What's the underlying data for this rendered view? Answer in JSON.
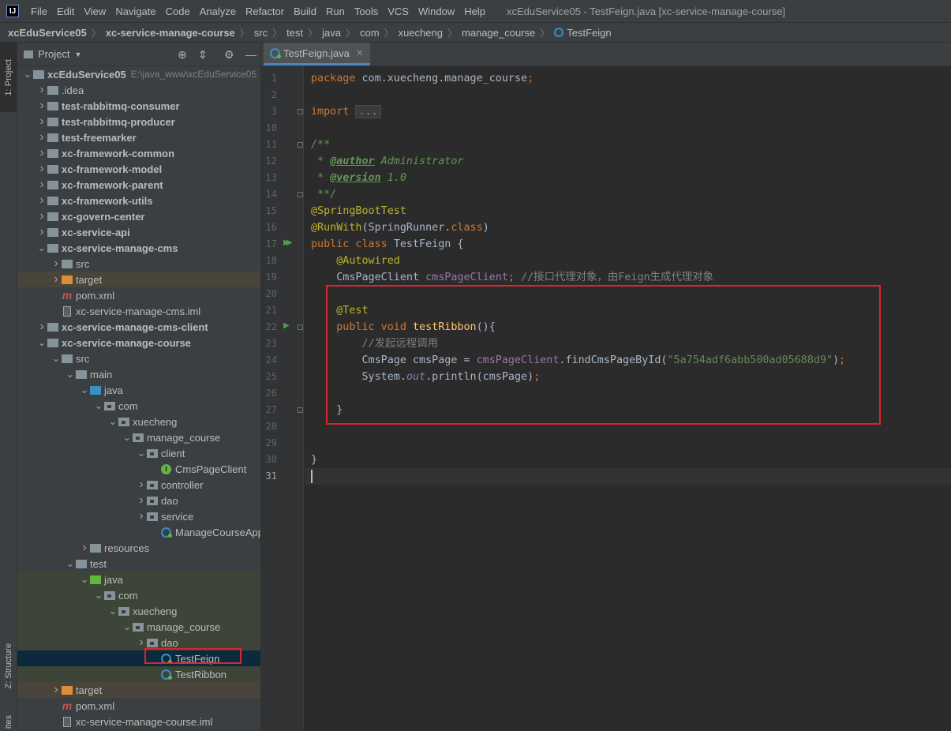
{
  "app": {
    "logo_text": "IJ",
    "window_title": "xcEduService05 - TestFeign.java [xc-service-manage-course]"
  },
  "menu": [
    "File",
    "Edit",
    "View",
    "Navigate",
    "Code",
    "Analyze",
    "Refactor",
    "Build",
    "Run",
    "Tools",
    "VCS",
    "Window",
    "Help"
  ],
  "breadcrumb": [
    "xcEduService05",
    "xc-service-manage-course",
    "src",
    "test",
    "java",
    "com",
    "xuecheng",
    "manage_course",
    "TestFeign"
  ],
  "toolwindows": {
    "project": "1: Project",
    "structure": "Z: Structure",
    "favorites": "ites"
  },
  "project_panel": {
    "title": "Project",
    "tree": [
      {
        "label": "xcEduService05",
        "path": "E:\\java_www\\xcEduService05",
        "depth": 0,
        "arrow": "down",
        "icon": "folder-grey",
        "bold": true
      },
      {
        "label": ".idea",
        "depth": 1,
        "arrow": "right",
        "icon": "folder-grey"
      },
      {
        "label": "test-rabbitmq-consumer",
        "depth": 1,
        "arrow": "right",
        "icon": "folder-grey",
        "bold": true
      },
      {
        "label": "test-rabbitmq-producer",
        "depth": 1,
        "arrow": "right",
        "icon": "folder-grey",
        "bold": true
      },
      {
        "label": "test-freemarker",
        "depth": 1,
        "arrow": "right",
        "icon": "folder-grey",
        "bold": true
      },
      {
        "label": "xc-framework-common",
        "depth": 1,
        "arrow": "right",
        "icon": "folder-grey",
        "bold": true
      },
      {
        "label": "xc-framework-model",
        "depth": 1,
        "arrow": "right",
        "icon": "folder-grey",
        "bold": true
      },
      {
        "label": "xc-framework-parent",
        "depth": 1,
        "arrow": "right",
        "icon": "folder-grey",
        "bold": true
      },
      {
        "label": "xc-framework-utils",
        "depth": 1,
        "arrow": "right",
        "icon": "folder-grey",
        "bold": true
      },
      {
        "label": "xc-govern-center",
        "depth": 1,
        "arrow": "right",
        "icon": "folder-grey",
        "bold": true
      },
      {
        "label": "xc-service-api",
        "depth": 1,
        "arrow": "right",
        "icon": "folder-grey",
        "bold": true
      },
      {
        "label": "xc-service-manage-cms",
        "depth": 1,
        "arrow": "down",
        "icon": "folder-grey",
        "bold": true
      },
      {
        "label": "src",
        "depth": 2,
        "arrow": "right",
        "icon": "folder-grey"
      },
      {
        "label": "target",
        "depth": 2,
        "arrow": "right",
        "icon": "folder-orange",
        "highlight": "orange"
      },
      {
        "label": "pom.xml",
        "depth": 2,
        "arrow": "",
        "icon": "maven"
      },
      {
        "label": "xc-service-manage-cms.iml",
        "depth": 2,
        "arrow": "",
        "icon": "iml"
      },
      {
        "label": "xc-service-manage-cms-client",
        "depth": 1,
        "arrow": "right",
        "icon": "folder-grey",
        "bold": true
      },
      {
        "label": "xc-service-manage-course",
        "depth": 1,
        "arrow": "down",
        "icon": "folder-grey",
        "bold": true
      },
      {
        "label": "src",
        "depth": 2,
        "arrow": "down",
        "icon": "folder-grey"
      },
      {
        "label": "main",
        "depth": 3,
        "arrow": "down",
        "icon": "folder-grey"
      },
      {
        "label": "java",
        "depth": 4,
        "arrow": "down",
        "icon": "folder-blue"
      },
      {
        "label": "com",
        "depth": 5,
        "arrow": "down",
        "icon": "package"
      },
      {
        "label": "xuecheng",
        "depth": 6,
        "arrow": "down",
        "icon": "package"
      },
      {
        "label": "manage_course",
        "depth": 7,
        "arrow": "down",
        "icon": "package"
      },
      {
        "label": "client",
        "depth": 8,
        "arrow": "down",
        "icon": "package"
      },
      {
        "label": "CmsPageClient",
        "depth": 9,
        "arrow": "",
        "icon": "interface"
      },
      {
        "label": "controller",
        "depth": 8,
        "arrow": "right",
        "icon": "package"
      },
      {
        "label": "dao",
        "depth": 8,
        "arrow": "right",
        "icon": "package"
      },
      {
        "label": "service",
        "depth": 8,
        "arrow": "right",
        "icon": "package"
      },
      {
        "label": "ManageCourseApplic",
        "depth": 9,
        "arrow": "",
        "icon": "class"
      },
      {
        "label": "resources",
        "depth": 4,
        "arrow": "right",
        "icon": "folder-grey"
      },
      {
        "label": "test",
        "depth": 3,
        "arrow": "down",
        "icon": "folder-grey"
      },
      {
        "label": "java",
        "depth": 4,
        "arrow": "down",
        "icon": "folder-green",
        "highlight": "green"
      },
      {
        "label": "com",
        "depth": 5,
        "arrow": "down",
        "icon": "package",
        "highlight": "green"
      },
      {
        "label": "xuecheng",
        "depth": 6,
        "arrow": "down",
        "icon": "package",
        "highlight": "green"
      },
      {
        "label": "manage_course",
        "depth": 7,
        "arrow": "down",
        "icon": "package",
        "highlight": "green"
      },
      {
        "label": "dao",
        "depth": 8,
        "arrow": "right",
        "icon": "package",
        "highlight": "green"
      },
      {
        "label": "TestFeign",
        "depth": 9,
        "arrow": "",
        "icon": "class",
        "highlight": "selected"
      },
      {
        "label": "TestRibbon",
        "depth": 9,
        "arrow": "",
        "icon": "class",
        "highlight": "green"
      },
      {
        "label": "target",
        "depth": 2,
        "arrow": "right",
        "icon": "folder-orange",
        "highlight": "orange"
      },
      {
        "label": "pom.xml",
        "depth": 2,
        "arrow": "",
        "icon": "maven"
      },
      {
        "label": "xc-service-manage-course.iml",
        "depth": 2,
        "arrow": "",
        "icon": "iml"
      }
    ]
  },
  "editor": {
    "tab_label": "TestFeign.java",
    "lines": [
      {
        "no": "1",
        "tokens": [
          [
            "kw",
            "package "
          ],
          [
            "",
            "com.xuecheng.manage_course"
          ],
          [
            "kw",
            ";"
          ]
        ]
      },
      {
        "no": "2",
        "tokens": []
      },
      {
        "no": "3",
        "tokens": [
          [
            "kw",
            "import "
          ],
          [
            "folded",
            "..."
          ]
        ],
        "fold": true
      },
      {
        "no": "10",
        "tokens": []
      },
      {
        "no": "11",
        "tokens": [
          [
            "doc",
            "/**"
          ]
        ],
        "fold": true
      },
      {
        "no": "12",
        "tokens": [
          [
            "doc",
            " * "
          ],
          [
            "doctag",
            "@author"
          ],
          [
            "doc",
            " Administrator"
          ]
        ]
      },
      {
        "no": "13",
        "tokens": [
          [
            "doc",
            " * "
          ],
          [
            "doctag",
            "@version"
          ],
          [
            "doc",
            " 1.0"
          ]
        ]
      },
      {
        "no": "14",
        "tokens": [
          [
            "doc",
            " **/"
          ]
        ],
        "fold": true
      },
      {
        "no": "15",
        "tokens": [
          [
            "ann",
            "@SpringBootTest"
          ]
        ]
      },
      {
        "no": "16",
        "tokens": [
          [
            "ann",
            "@RunWith"
          ],
          [
            "",
            "(SpringRunner."
          ],
          [
            "kw",
            "class"
          ],
          [
            "",
            ")"
          ]
        ]
      },
      {
        "no": "17",
        "tokens": [
          [
            "kw",
            "public class "
          ],
          [
            "",
            "TestFeign {"
          ]
        ],
        "run": "double"
      },
      {
        "no": "18",
        "tokens": [
          [
            "",
            "    "
          ],
          [
            "ann",
            "@Autowired"
          ]
        ]
      },
      {
        "no": "19",
        "tokens": [
          [
            "",
            "    CmsPageClient "
          ],
          [
            "fld",
            "cmsPageClient"
          ],
          [
            "kw",
            "; "
          ],
          [
            "cmt",
            "//接口代理对象，由Feign生成代理对象"
          ]
        ]
      },
      {
        "no": "20",
        "tokens": []
      },
      {
        "no": "21",
        "tokens": [
          [
            "",
            "    "
          ],
          [
            "ann",
            "@Test"
          ]
        ]
      },
      {
        "no": "22",
        "tokens": [
          [
            "",
            "    "
          ],
          [
            "kw",
            "public void "
          ],
          [
            "mth",
            "testRibbon"
          ],
          [
            "",
            "(){"
          ]
        ],
        "run": "single",
        "fold": true
      },
      {
        "no": "23",
        "tokens": [
          [
            "",
            "        "
          ],
          [
            "cmt",
            "//发起远程调用"
          ]
        ]
      },
      {
        "no": "24",
        "tokens": [
          [
            "",
            "        CmsPage cmsPage = "
          ],
          [
            "fld",
            "cmsPageClient"
          ],
          [
            "",
            ".findCmsPageById("
          ],
          [
            "str",
            "\"5a754adf6abb500ad05688d9\""
          ],
          [
            "",
            ")"
          ],
          [
            "kw",
            ";"
          ]
        ]
      },
      {
        "no": "25",
        "tokens": [
          [
            "",
            "        System."
          ],
          [
            "fld-i",
            "out"
          ],
          [
            "",
            ".println(cmsPage)"
          ],
          [
            "kw",
            ";"
          ]
        ]
      },
      {
        "no": "26",
        "tokens": []
      },
      {
        "no": "27",
        "tokens": [
          [
            "",
            "    }"
          ]
        ],
        "fold": true
      },
      {
        "no": "28",
        "tokens": []
      },
      {
        "no": "29",
        "tokens": []
      },
      {
        "no": "30",
        "tokens": [
          [
            "",
            "}"
          ]
        ]
      },
      {
        "no": "31",
        "tokens": [],
        "current": true
      }
    ]
  },
  "colors": {
    "keyword": "#cc7832",
    "annotation": "#bbb529",
    "string": "#6a8759",
    "field": "#9876aa",
    "comment": "#808080",
    "javadoc": "#629755",
    "highlight_box": "#d9262d"
  }
}
